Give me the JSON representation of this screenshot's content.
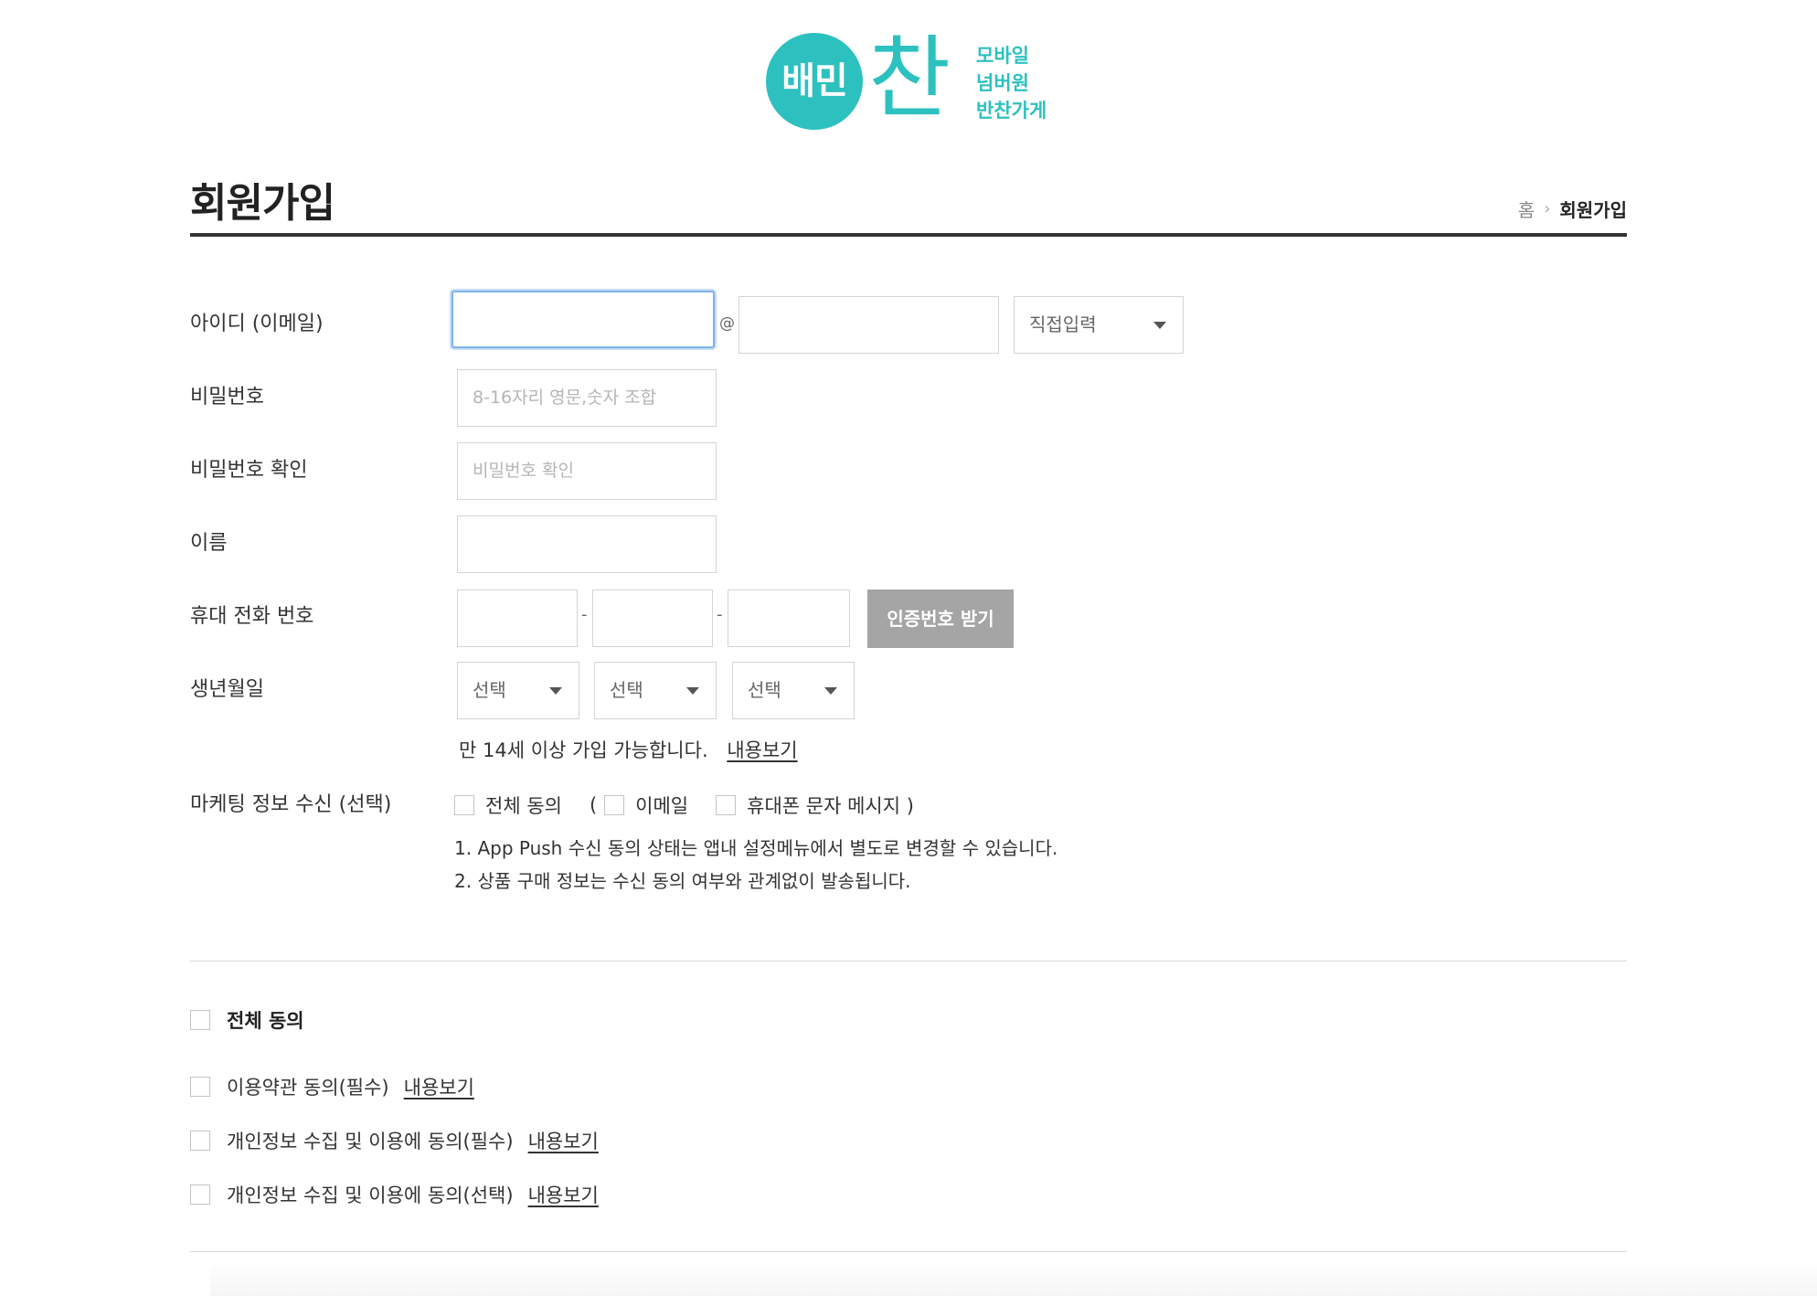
{
  "logo": {
    "circle_text": "배민",
    "big_char": "찬",
    "tagline": [
      "모바일",
      "넘버원",
      "반찬가게"
    ],
    "brand_color": "#2cc1bf"
  },
  "header": {
    "title": "회원가입",
    "breadcrumb": {
      "home": "홈",
      "current": "회원가입"
    }
  },
  "form": {
    "id": {
      "label": "아이디 (이메일)",
      "local_value": "",
      "at": "@",
      "domain_value": "",
      "domain_select": "직접입력"
    },
    "password": {
      "label": "비밀번호",
      "placeholder": "8-16자리 영문,숫자 조합"
    },
    "password_confirm": {
      "label": "비밀번호 확인",
      "placeholder": "비밀번호 확인"
    },
    "name": {
      "label": "이름",
      "value": ""
    },
    "phone": {
      "label": "휴대 전화 번호",
      "sep": "-",
      "verify_button": "인증번호 받기"
    },
    "birth": {
      "label": "생년월일",
      "year": "선택",
      "month": "선택",
      "day": "선택",
      "age_note": "만 14세 이상 가입 가능합니다.",
      "age_link": "내용보기"
    },
    "marketing": {
      "label": "마케팅 정보 수신 (선택)",
      "all": "전체 동의",
      "open_paren": "(",
      "email": "이메일",
      "sms": "휴대폰 문자 메시지 )",
      "notes": [
        "1. App Push 수신 동의 상태는 앱내 설정메뉴에서 별도로 변경할 수 있습니다.",
        "2. 상품 구매 정보는 수신 동의 여부와 관계없이 발송됩니다."
      ]
    }
  },
  "agreements": {
    "all_label": "전체 동의",
    "items": [
      {
        "label": "이용약관 동의(필수)",
        "link": "내용보기"
      },
      {
        "label": "개인정보 수집 및 이용에 동의(필수)",
        "link": "내용보기"
      },
      {
        "label": "개인정보 수집 및 이용에 동의(선택)",
        "link": "내용보기"
      }
    ]
  }
}
